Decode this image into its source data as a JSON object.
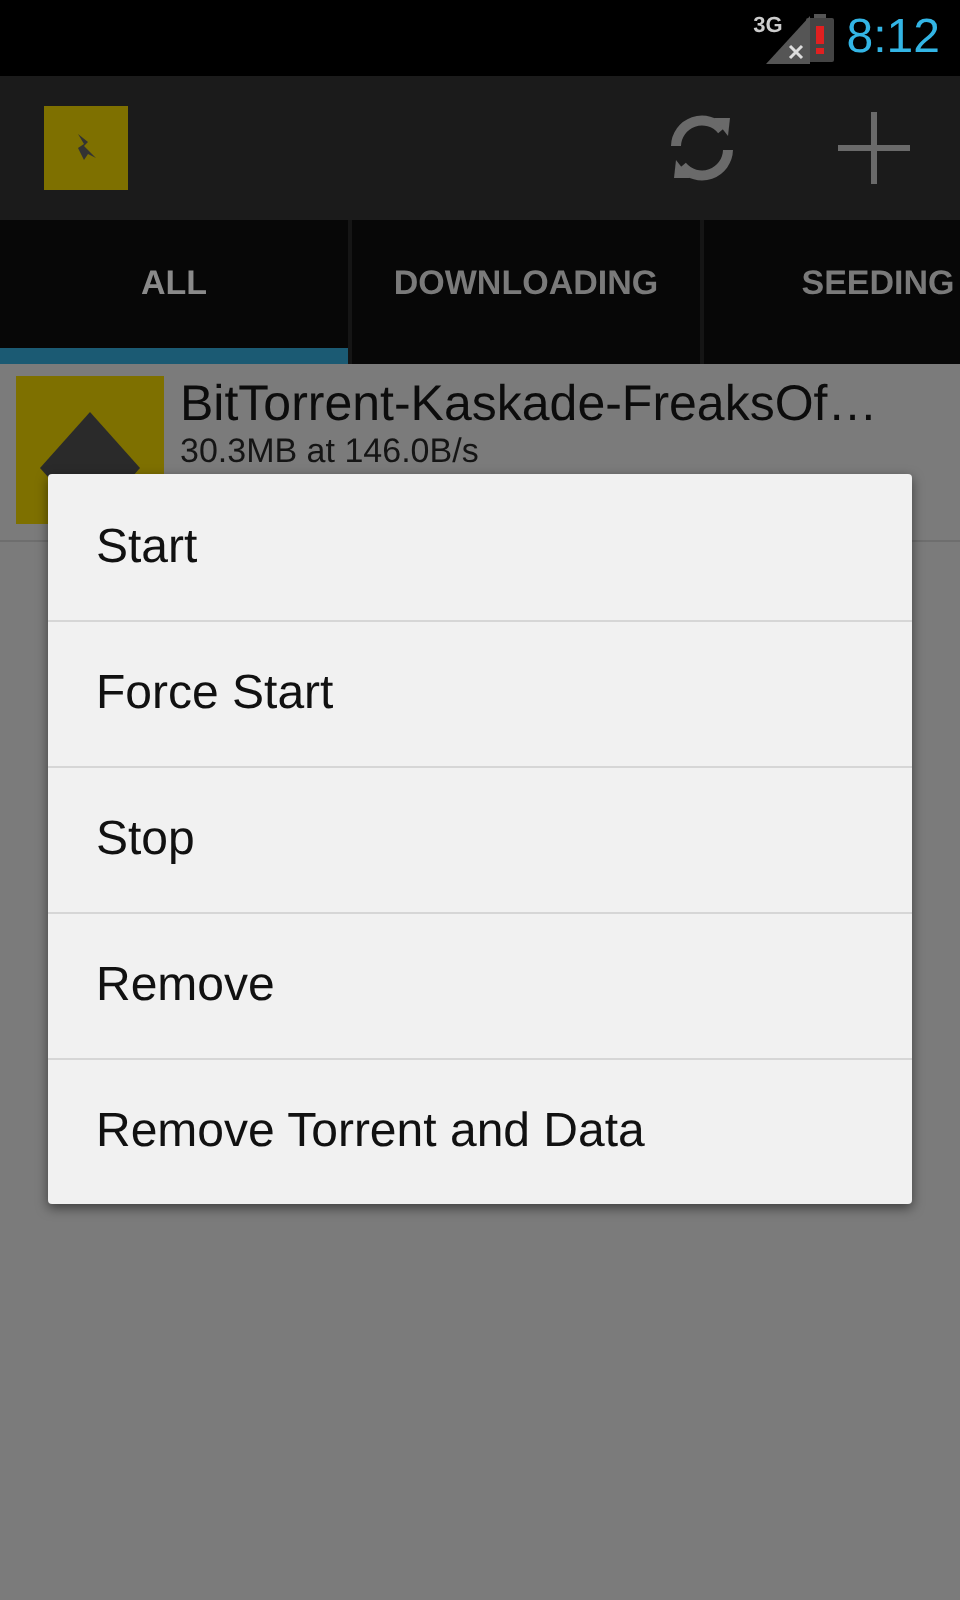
{
  "status_bar": {
    "network": "3G",
    "time": "8:12"
  },
  "tabs": [
    {
      "label": "ALL",
      "selected": true
    },
    {
      "label": "DOWNLOADING",
      "selected": false
    },
    {
      "label": "SEEDING",
      "selected": false
    }
  ],
  "torrents": [
    {
      "name": "BitTorrent-Kaskade-FreaksOf…",
      "detail": "30.3MB at 146.0B/s"
    }
  ],
  "menu": {
    "items": [
      "Start",
      "Force Start",
      "Stop",
      "Remove",
      "Remove Torrent and Data"
    ]
  }
}
